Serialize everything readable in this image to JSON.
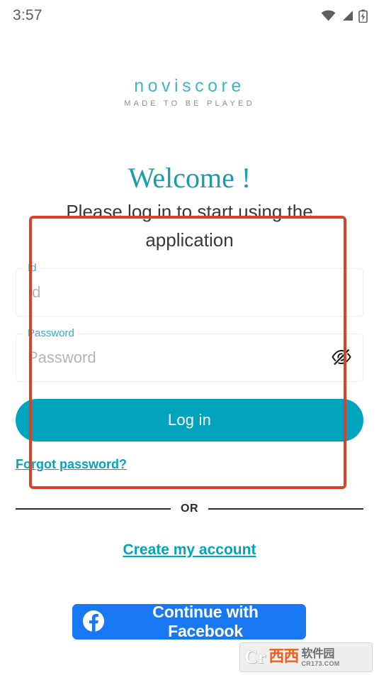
{
  "status_bar": {
    "clock": "3:57",
    "icons": [
      "wifi-icon",
      "cell-signal-icon",
      "battery-charging-icon"
    ]
  },
  "brand": {
    "name": "noviscore",
    "tagline": "MADE TO BE PLAYED",
    "accent_color": "#00a5bd"
  },
  "heading": {
    "title": "Welcome !",
    "subtitle": "Please log in to start using the application"
  },
  "form": {
    "id_field": {
      "label": "Id",
      "placeholder": "Id",
      "value": ""
    },
    "password_field": {
      "label": "Password",
      "placeholder": "Password",
      "value": "",
      "toggle_icon": "eye-off-icon"
    },
    "login_button": "Log in",
    "forgot_link": "Forgot password?"
  },
  "divider": {
    "text": "OR"
  },
  "create_account_link": "Create my account",
  "facebook_button": {
    "label": "Continue with Facebook",
    "icon": "facebook-icon",
    "color": "#1877f2"
  },
  "annotation": {
    "color": "#dc4127"
  },
  "watermark": {
    "mark": "Cr",
    "name": "西西",
    "suffix": "软件园",
    "url": "CR173.COM"
  }
}
